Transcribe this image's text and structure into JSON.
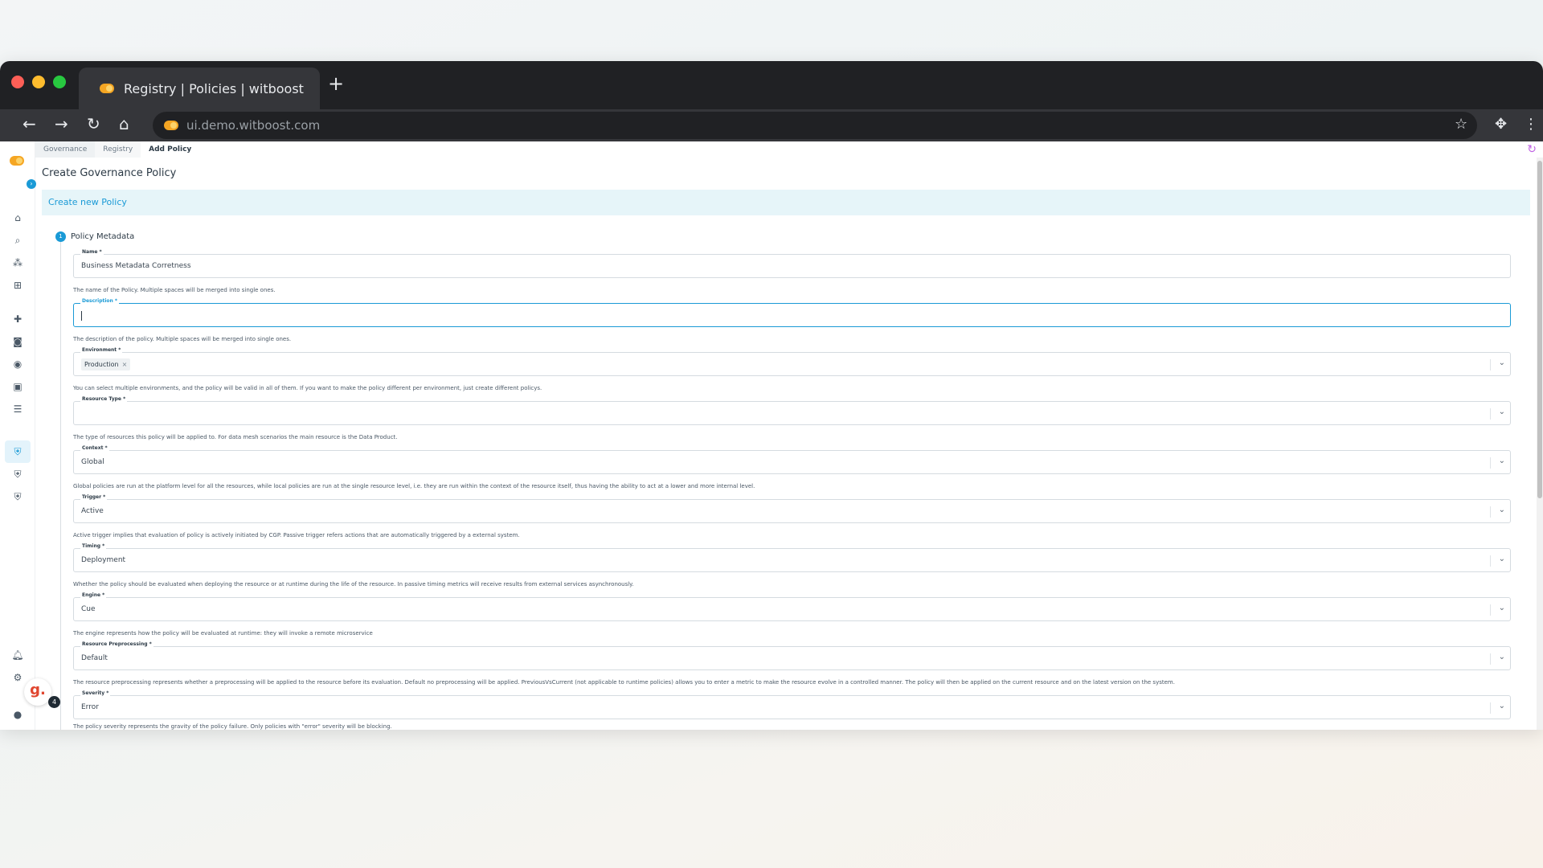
{
  "browser": {
    "tab_title": "Registry | Policies | witboost",
    "new_tab": "+",
    "url": "ui.demo.witboost.com",
    "icons": [
      "back-icon",
      "forward-icon",
      "reload-icon",
      "home-icon",
      "star-icon",
      "extensions-icon",
      "menu-icon"
    ]
  },
  "breadcrumbs": [
    "Governance",
    "Registry",
    "Add Policy"
  ],
  "page": {
    "title": "Create Governance Policy",
    "panel_title": "Create new Policy"
  },
  "step": {
    "number": "1",
    "label": "Policy Metadata"
  },
  "fields": {
    "name": {
      "label": "Name *",
      "value": "Business Metadata Corretness",
      "help": "The name of the Policy. Multiple spaces will be merged into single ones."
    },
    "description": {
      "label": "Description *",
      "value": "",
      "help": "The description of the policy. Multiple spaces will be merged into single ones."
    },
    "environment": {
      "label": "Environment *",
      "chip": "Production",
      "chip_remove": "×",
      "help": "You can select multiple environments, and the policy will be valid in all of them. If you want to make the policy different per environment, just create different policys."
    },
    "resource_type": {
      "label": "Resource Type *",
      "value": "",
      "help": "The type of resources this policy will be applied to. For data mesh scenarios the main resource is the Data Product."
    },
    "context": {
      "label": "Context *",
      "value": "Global",
      "help": "Global policies are run at the platform level for all the resources, while local policies are run at the single resource level, i.e. they are run within the context of the resource itself, thus having the ability to act at a lower and more internal level."
    },
    "trigger": {
      "label": "Trigger *",
      "value": "Active",
      "help": "Active trigger implies that evaluation of policy is actively initiated by CGP. Passive trigger refers actions that are automatically triggered by a external system."
    },
    "timing": {
      "label": "Timing *",
      "value": "Deployment",
      "help": "Whether the policy should be evaluated when deploying the resource or at runtime during the life of the resource. In passive timing metrics will receive results from external services asynchronously."
    },
    "engine": {
      "label": "Engine *",
      "value": "Cue",
      "help": "The engine represents how the policy will be evaluated at runtime: they will invoke a remote microservice"
    },
    "resource_preprocessing": {
      "label": "Resource Preprocessing *",
      "value": "Default",
      "help": "The resource preprocessing represents whether a preprocessing will be applied to the resource before its evaluation. Default no preprocessing will be applied. PreviousVsCurrent (not applicable to runtime policies) allows you to enter a metric to make the resource evolve in a controlled manner. The policy will then be applied on the current resource and on the latest version on the system."
    },
    "severity": {
      "label": "Severity *",
      "value": "Error",
      "help": "The policy severity represents the gravity of the policy failure. Only policies with \"error\" severity will be blocking."
    }
  },
  "widget": {
    "letter": "g.",
    "count": "4"
  },
  "colors": {
    "accent": "#1a9ad6",
    "panel_bg": "#e6f5f9",
    "brand": "#f5a623"
  }
}
